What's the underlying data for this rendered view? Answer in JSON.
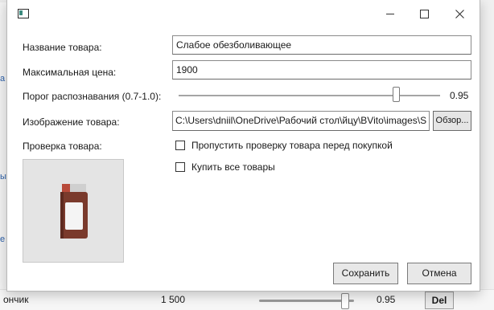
{
  "background": {
    "left_fragments": [
      "а",
      "ы",
      "е"
    ],
    "bottom_row": {
      "name": "ончик",
      "price": "1 500",
      "threshold": "0.95",
      "delete_label": "Del",
      "threshold_level": 0.9
    }
  },
  "dialog": {
    "form": {
      "name_label": "Название товара:",
      "name_value": "Слабое обезболивающее",
      "max_price_label": "Максимальная цена:",
      "max_price_value": "1900",
      "threshold_label": "Порог распознавания (0.7-1.0):",
      "threshold_value": "0.95",
      "threshold_level": 0.83,
      "image_label": "Изображение товара:",
      "image_path": "C:\\Users\\dniil\\OneDrive\\Рабочий стол\\йцу\\BVito\\images\\S",
      "browse_label": "Обзор...",
      "check_label": "Проверка товара:",
      "skip_check_label": "Пропустить проверку товара перед покупкой",
      "buy_all_label": "Купить все товары"
    },
    "buttons": {
      "save": "Сохранить",
      "cancel": "Отмена"
    }
  },
  "colors": {
    "bottle_body": "#7a3a2c",
    "bottle_label": "#f4f4f4",
    "link_text": "#2b5fa8"
  }
}
